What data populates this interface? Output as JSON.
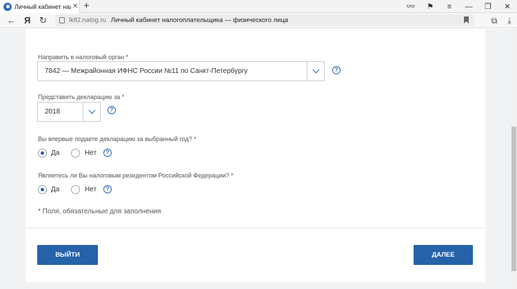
{
  "browser": {
    "tab_title": "Личный кабинет налогоп",
    "url_domain": "lkfl2.nalog.ru",
    "page_title": "Личный кабинет налогоплательщика — физического лица"
  },
  "form": {
    "tax_authority": {
      "label": "Направить в налоговый орган *",
      "value": "7842 — Межрайонная ИФНС России №11 по Санкт-Петербургу"
    },
    "year": {
      "label": "Представить декларацию за *",
      "value": "2018"
    },
    "first_time": {
      "label": "Вы впервые подаете декларацию за выбранный год? *",
      "yes": "Да",
      "no": "Нет",
      "selected": "yes"
    },
    "resident": {
      "label": "Являетесь ли Вы налоговым резидентом Российской Федерации? *",
      "yes": "Да",
      "no": "Нет",
      "selected": "yes"
    },
    "required_note": "* Поля, обязательные для заполнения"
  },
  "buttons": {
    "exit": "ВЫЙТИ",
    "next": "ДАЛЕЕ"
  },
  "colors": {
    "accent": "#2562a8",
    "page_bg": "#f1f2f4"
  }
}
